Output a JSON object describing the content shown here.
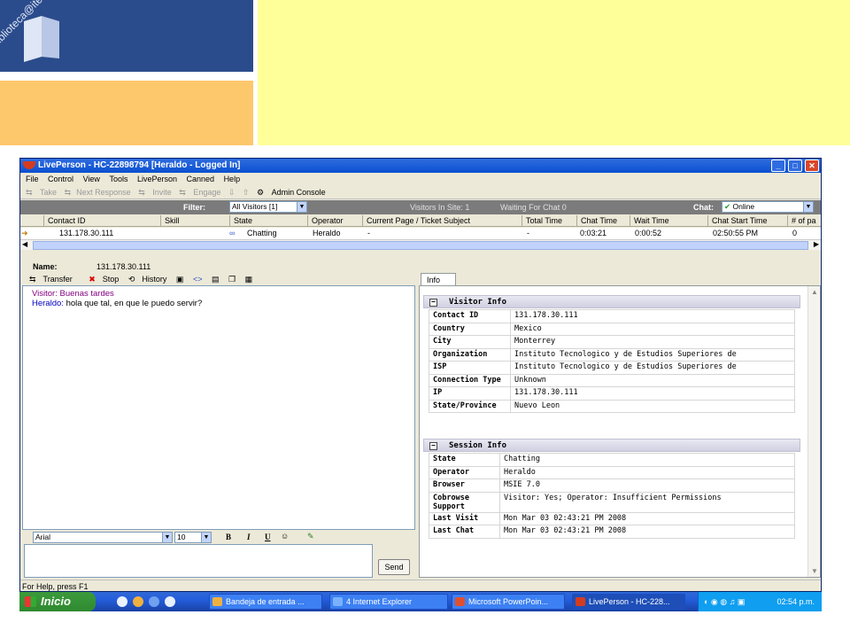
{
  "slide": {
    "logo_text": "biblioteca@itesm.mx"
  },
  "window": {
    "title": "LivePerson - HC-22898794 [Heraldo - Logged In]",
    "menu": [
      "File",
      "Control",
      "View",
      "Tools",
      "LivePerson",
      "Canned",
      "Help"
    ],
    "toolbar": {
      "take": "Take",
      "next_response": "Next Response",
      "invite": "Invite",
      "engage": "Engage",
      "admin_console": "Admin Console"
    },
    "filterbar": {
      "filter_label": "Filter:",
      "filter_value": "All Visitors [1]",
      "visitors_in_site": "Visitors In Site: 1",
      "waiting_for_chat": "Waiting For Chat 0",
      "chat_label": "Chat:",
      "chat_status": "Online"
    },
    "grid": {
      "headers": [
        "Contact ID",
        "Skill",
        "State",
        "Operator",
        "Current Page / Ticket Subject",
        "Total Time",
        "Chat Time",
        "Wait Time",
        "Chat Start Time",
        "# of pa"
      ],
      "row": {
        "contact_id": "131.178.30.111",
        "state": "Chatting",
        "operator": "Heraldo",
        "current_page": "-",
        "total_time": "-",
        "chat_time": "0:03:21",
        "wait_time": "0:00:52",
        "chat_start": "02:50:55 PM",
        "pages": "0"
      }
    },
    "name_label": "Name:",
    "name_value": "131.178.30.111",
    "chat_toolbar": {
      "transfer": "Transfer",
      "stop": "Stop",
      "history": "History"
    },
    "chat": [
      {
        "speaker": "Visitor:",
        "text": "Buenas tardes"
      },
      {
        "speaker": "Heraldo:",
        "text": "hola que tal, en que le puedo servir?"
      }
    ],
    "format": {
      "font": "Arial",
      "size": "10",
      "bold": "B",
      "italic": "I",
      "underline": "U"
    },
    "send_label": "Send",
    "info_tab": "Info",
    "visitor_info": {
      "title": "Visitor Info",
      "rows": [
        {
          "k": "Contact ID",
          "v": "131.178.30.111"
        },
        {
          "k": "Country",
          "v": "Mexico"
        },
        {
          "k": "City",
          "v": "Monterrey"
        },
        {
          "k": "Organization",
          "v": "Instituto Tecnologico y de Estudios Superiores de"
        },
        {
          "k": "ISP",
          "v": "Instituto Tecnologico y de Estudios Superiores de"
        },
        {
          "k": "Connection Type",
          "v": "Unknown"
        },
        {
          "k": "IP",
          "v": "131.178.30.111"
        },
        {
          "k": "State/Province",
          "v": "Nuevo Leon"
        }
      ]
    },
    "session_info": {
      "title": "Session Info",
      "rows": [
        {
          "k": "State",
          "v": "Chatting"
        },
        {
          "k": "Operator",
          "v": "Heraldo"
        },
        {
          "k": "Browser",
          "v": "MSIE 7.0"
        },
        {
          "k": "Cobrowse Support",
          "v": "Visitor: Yes; Operator: Insufficient Permissions"
        },
        {
          "k": "Last Visit",
          "v": "Mon Mar 03 02:43:21 PM 2008"
        },
        {
          "k": "Last Chat",
          "v": "Mon Mar 03 02:43:21 PM 2008"
        }
      ]
    },
    "status_text": "For Help, press F1"
  },
  "taskbar": {
    "start": "Inicio",
    "tasks": [
      "Bandeja de entrada ...",
      "4 Internet Explorer",
      "Microsoft PowerPoin...",
      "LivePerson - HC-228..."
    ],
    "clock": "02:54 p.m."
  },
  "colors": {
    "slide_blue": "#2b4c8c",
    "slide_orange": "#fdc86c",
    "slide_yellow": "#ffff99",
    "titlebar": "#0a50d0",
    "visitor_text": "#800080",
    "operator_text": "#0000c0"
  }
}
